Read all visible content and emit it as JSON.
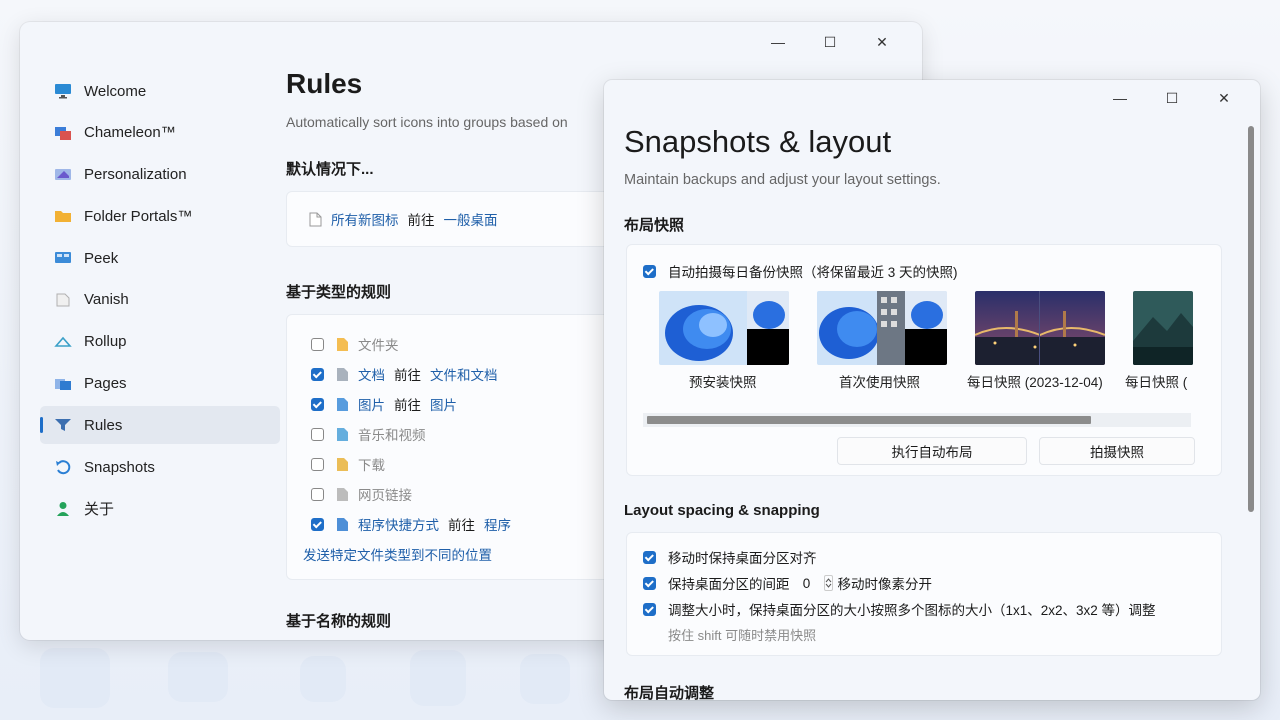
{
  "back_window": {
    "controls": {
      "minimize": "—",
      "maximize": "☐",
      "close": "✕"
    },
    "sidebar": [
      {
        "label": "Welcome",
        "icon": "monitor-icon",
        "color": "#2a8ad4"
      },
      {
        "label": "Chameleon™",
        "icon": "chameleon-icon",
        "color": "#d9534f"
      },
      {
        "label": "Personalization",
        "icon": "personalization-icon",
        "color": "#6a5acd"
      },
      {
        "label": "Folder Portals™",
        "icon": "folder-icon",
        "color": "#f2b134"
      },
      {
        "label": "Peek",
        "icon": "peek-icon",
        "color": "#3b8bd8"
      },
      {
        "label": "Vanish",
        "icon": "vanish-icon",
        "color": "#b0b0b0"
      },
      {
        "label": "Rollup",
        "icon": "rollup-icon",
        "color": "#3aa0c8"
      },
      {
        "label": "Pages",
        "icon": "pages-icon",
        "color": "#2f7bd0"
      },
      {
        "label": "Rules",
        "icon": "funnel-icon",
        "color": "#3c6fb0"
      },
      {
        "label": "Snapshots",
        "icon": "snapshot-icon",
        "color": "#2a7fd4"
      },
      {
        "label": "关于",
        "icon": "about-icon",
        "color": "#24a35a"
      }
    ],
    "title": "Rules",
    "subtitle": "Automatically sort icons into groups based on",
    "default_heading": "默认情况下...",
    "default_rule": {
      "item": "所有新图标",
      "arrow": "前往",
      "target": "一般桌面"
    },
    "type_heading": "基于类型的规则",
    "type_rules": [
      {
        "label": "文件夹",
        "checked": false,
        "arrow": "",
        "target": ""
      },
      {
        "label": "文档",
        "checked": true,
        "arrow": "前往",
        "target": "文件和文档"
      },
      {
        "label": "图片",
        "checked": true,
        "arrow": "前往",
        "target": "图片"
      },
      {
        "label": "音乐和视频",
        "checked": false,
        "arrow": "",
        "target": ""
      },
      {
        "label": "下载",
        "checked": false,
        "arrow": "",
        "target": ""
      },
      {
        "label": "网页链接",
        "checked": false,
        "arrow": "",
        "target": ""
      },
      {
        "label": "程序快捷方式",
        "checked": true,
        "arrow": "前往",
        "target": "程序"
      }
    ],
    "type_rules_link": "发送特定文件类型到不同的位置",
    "name_heading": "基于名称的规则"
  },
  "front_window": {
    "controls": {
      "minimize": "—",
      "maximize": "☐",
      "close": "✕"
    },
    "title": "Snapshots & layout",
    "subtitle": "Maintain backups and adjust your layout settings.",
    "snapshots_heading": "布局快照",
    "auto_snapshot_label": "自动拍摄每日备份快照（将保留最近 3 天的快照)",
    "snapshots": [
      {
        "label": "预安装快照"
      },
      {
        "label": "首次使用快照"
      },
      {
        "label": "每日快照 (2023-12-04)"
      },
      {
        "label": "每日快照 ("
      }
    ],
    "auto_layout_button": "执行自动布局",
    "take_snapshot_button": "拍摄快照",
    "spacing_heading": "Layout spacing & snapping",
    "option_align": "移动时保持桌面分区对齐",
    "option_spacing_prefix": "保持桌面分区的间距",
    "option_spacing_value": "0",
    "option_spacing_suffix": "移动时像素分开",
    "option_resize": "调整大小时，保持桌面分区的大小按照多个图标的大小（1x1、2x2、3x2 等）调整",
    "hint": "按住 shift 可随时禁用快照",
    "auto_adjust_heading": "布局自动调整"
  },
  "colors": {
    "accent": "#1e6ec8",
    "link": "#1f5fa9"
  }
}
